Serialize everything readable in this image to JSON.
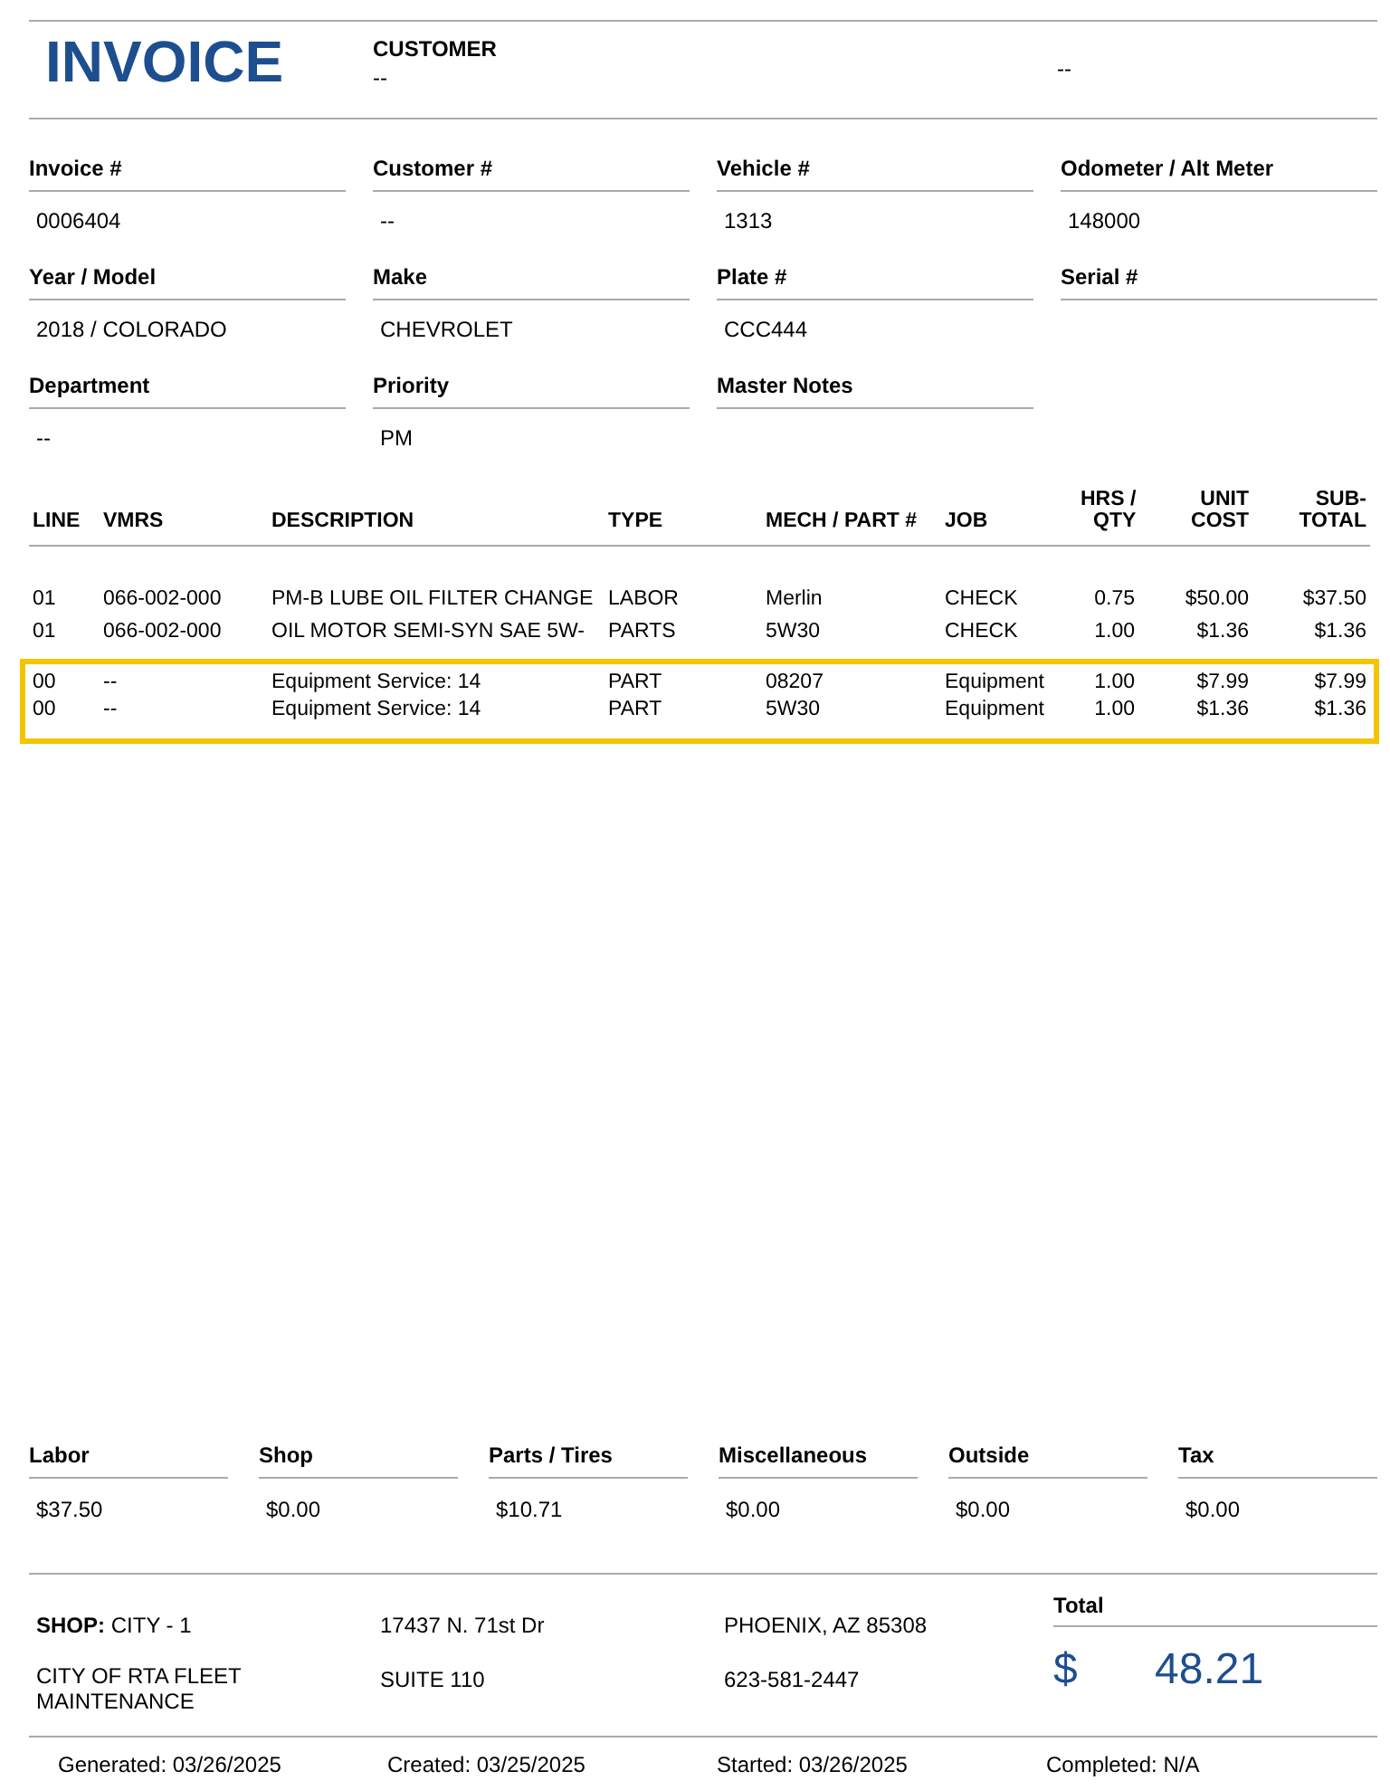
{
  "title": "INVOICE",
  "customer": {
    "label": "CUSTOMER",
    "value": "--",
    "extra": "--"
  },
  "fields": [
    {
      "label": "Invoice #",
      "value": "0006404"
    },
    {
      "label": "Customer #",
      "value": "--"
    },
    {
      "label": "Vehicle #",
      "value": "1313"
    },
    {
      "label": "Odometer / Alt Meter",
      "value": "148000"
    },
    {
      "label": "Year / Model",
      "value": "2018 / COLORADO"
    },
    {
      "label": "Make",
      "value": "CHEVROLET"
    },
    {
      "label": "Plate #",
      "value": "CCC444"
    },
    {
      "label": "Serial #"
    },
    {
      "label": "Department",
      "value": "--"
    },
    {
      "label": "Priority",
      "value": "PM"
    },
    {
      "label": "Master Notes"
    }
  ],
  "table": {
    "columns": [
      [
        "LINE"
      ],
      [
        "VMRS"
      ],
      [
        "DESCRIPTION"
      ],
      [
        "TYPE"
      ],
      [
        "MECH / PART #"
      ],
      [
        "JOB"
      ],
      [
        "HRS /",
        "QTY"
      ],
      [
        "UNIT",
        "COST"
      ],
      [
        "SUB-",
        "TOTAL"
      ]
    ],
    "groups": [
      {
        "highlighted": false,
        "rows": [
          [
            "01",
            "066-002-000",
            "PM-B LUBE OIL FILTER CHANGE",
            "LABOR",
            "Merlin",
            "CHECK",
            "0.75",
            "$50.00",
            "$37.50"
          ],
          [
            "01",
            "066-002-000",
            "OIL MOTOR SEMI-SYN SAE 5W-",
            "PARTS",
            "5W30",
            "CHECK",
            "1.00",
            "$1.36",
            "$1.36"
          ]
        ]
      },
      {
        "highlighted": true,
        "rows": [
          [
            "00",
            "--",
            "Equipment Service: 14",
            "PART",
            "08207",
            "Equipment",
            "1.00",
            "$7.99",
            "$7.99"
          ],
          [
            "00",
            "--",
            "Equipment Service: 14",
            "PART",
            "5W30",
            "Equipment",
            "1.00",
            "$1.36",
            "$1.36"
          ]
        ]
      }
    ]
  },
  "totals": [
    {
      "label": "Labor",
      "value": "$37.50"
    },
    {
      "label": "Shop",
      "value": "$0.00"
    },
    {
      "label": "Parts / Tires",
      "value": "$10.71"
    },
    {
      "label": "Miscellaneous",
      "value": "$0.00"
    },
    {
      "label": "Outside",
      "value": "$0.00"
    },
    {
      "label": "Tax",
      "value": "$0.00"
    }
  ],
  "shop": {
    "label": "SHOP:",
    "name": "CITY - 1",
    "org": "CITY OF RTA FLEET MAINTENANCE",
    "address1": "17437 N. 71st Dr",
    "address2": "SUITE 110",
    "city": "PHOENIX, AZ 85308",
    "phone": "623-581-2447"
  },
  "total": {
    "label": "Total",
    "currency": "$",
    "amount": "48.21"
  },
  "dates": [
    "Generated: 03/26/2025",
    "Created: 03/25/2025",
    "Started: 03/26/2025",
    "Completed: N/A"
  ]
}
